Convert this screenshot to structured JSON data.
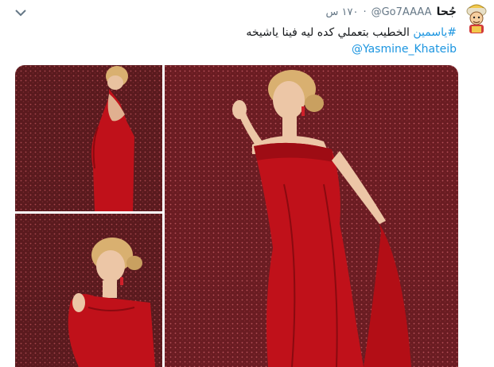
{
  "tweet": {
    "author_name": "جُحا",
    "handle": "@Go7AAAA",
    "separator": "·",
    "time": "١٧٠ س",
    "text_hashtag": "#ياسمين",
    "text_body": " الخطيب بتعملي كده ليه فينا ياشيخه",
    "mention": "@Yasmine_Khateib"
  },
  "icons": {
    "menu": "chevron-down-icon",
    "avatar": "cartoon-avatar"
  },
  "colors": {
    "link": "#1b95e0",
    "secondary_text": "#657786",
    "dress": "#c0111a",
    "backdrop": "#5a1a1e"
  },
  "media": {
    "photos": [
      "photo-1",
      "photo-2",
      "photo-3"
    ]
  }
}
